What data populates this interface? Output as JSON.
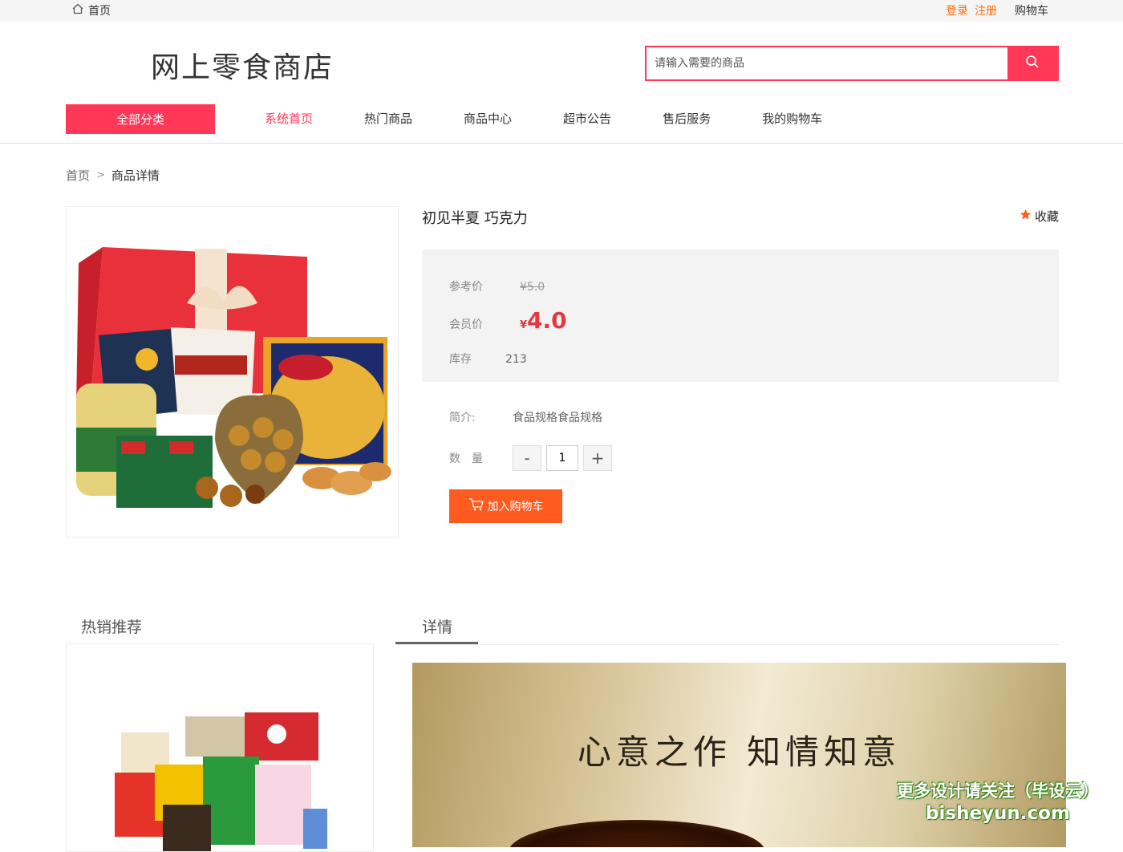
{
  "topbar": {
    "home": "首页",
    "login": "登录",
    "register": "注册",
    "cart": "购物车"
  },
  "header": {
    "logo": "网上零食商店",
    "search_placeholder": "请输入需要的商品"
  },
  "nav": {
    "all_categories": "全部分类",
    "items": [
      "系统首页",
      "热门商品",
      "商品中心",
      "超市公告",
      "售后服务",
      "我的购物车"
    ],
    "active": "系统首页"
  },
  "breadcrumb": {
    "home": "首页",
    "sep": ">",
    "current": "商品详情"
  },
  "product": {
    "title": "初见半夏 巧克力",
    "favorite": "收藏",
    "ref_price_label": "参考价",
    "ref_price": "¥5.0",
    "member_price_label": "会员价",
    "currency": "¥",
    "member_price": "4.0",
    "stock_label": "库存",
    "stock": "213",
    "intro_label": "简介:",
    "intro": "食品规格食品规格",
    "qty_label": "数　量",
    "qty": "1",
    "minus": "-",
    "plus": "+",
    "add_to_cart": "加入购物车"
  },
  "hot": {
    "title": "热销推荐"
  },
  "detail": {
    "tab": "详情",
    "banner_text": "心意之作 知情知意"
  },
  "watermark": {
    "line1": "更多设计请关注（毕设云）",
    "line2": "bisheyun.com"
  },
  "colors": {
    "accent": "#ff3857",
    "orange": "#ff5a1f",
    "price": "#e4393c",
    "link": "#ff6a00"
  }
}
